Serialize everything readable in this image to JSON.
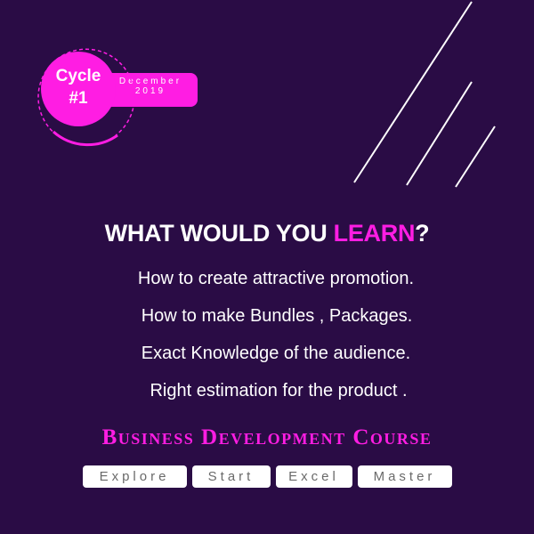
{
  "colors": {
    "background": "#2a0c45",
    "accent": "#ff1de3",
    "text": "#ffffff",
    "pill_text": "#6a6a6a"
  },
  "badge": {
    "cycle_label": "Cycle",
    "cycle_number": "#1",
    "month": "December",
    "year": "2019"
  },
  "headline": {
    "prefix": "WHAT WOULD YOU ",
    "highlight": "LEARN",
    "suffix": "?"
  },
  "points": [
    "How to create attractive promotion.",
    "How to make Bundles , Packages.",
    "Exact Knowledge of the audience.",
    "Right estimation for the product ."
  ],
  "course_title": "Business Development Course",
  "stages": [
    "Explore",
    "Start",
    "Excel",
    "Master"
  ]
}
